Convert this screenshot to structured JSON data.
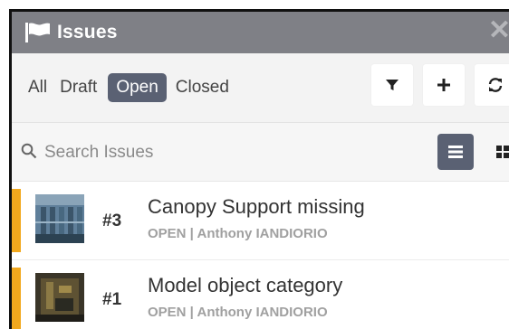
{
  "window": {
    "title": "Issues",
    "icon": "flag-icon",
    "close_icon": "close-icon"
  },
  "tabs": [
    {
      "label": "All",
      "active": false
    },
    {
      "label": "Draft",
      "active": false
    },
    {
      "label": "Open",
      "active": true
    },
    {
      "label": "Closed",
      "active": false
    }
  ],
  "toolbar": {
    "filter_icon": "filter-icon",
    "add_icon": "plus-icon",
    "refresh_icon": "refresh-icon"
  },
  "search": {
    "placeholder": "Search Issues",
    "value": ""
  },
  "view_toggle": {
    "list_icon": "list-view-icon",
    "grid_icon": "grid-view-icon",
    "selected": "list"
  },
  "issues": [
    {
      "number": "#3",
      "title": "Canopy Support missing",
      "meta": "OPEN | Anthony IANDIORIO"
    },
    {
      "number": "#1",
      "title": "Model object category",
      "meta": "OPEN | Anthony IANDIORIO"
    }
  ],
  "colors": {
    "titlebar": "#7f8086",
    "accent": "#5a6173",
    "status_open": "#f2a81d"
  }
}
